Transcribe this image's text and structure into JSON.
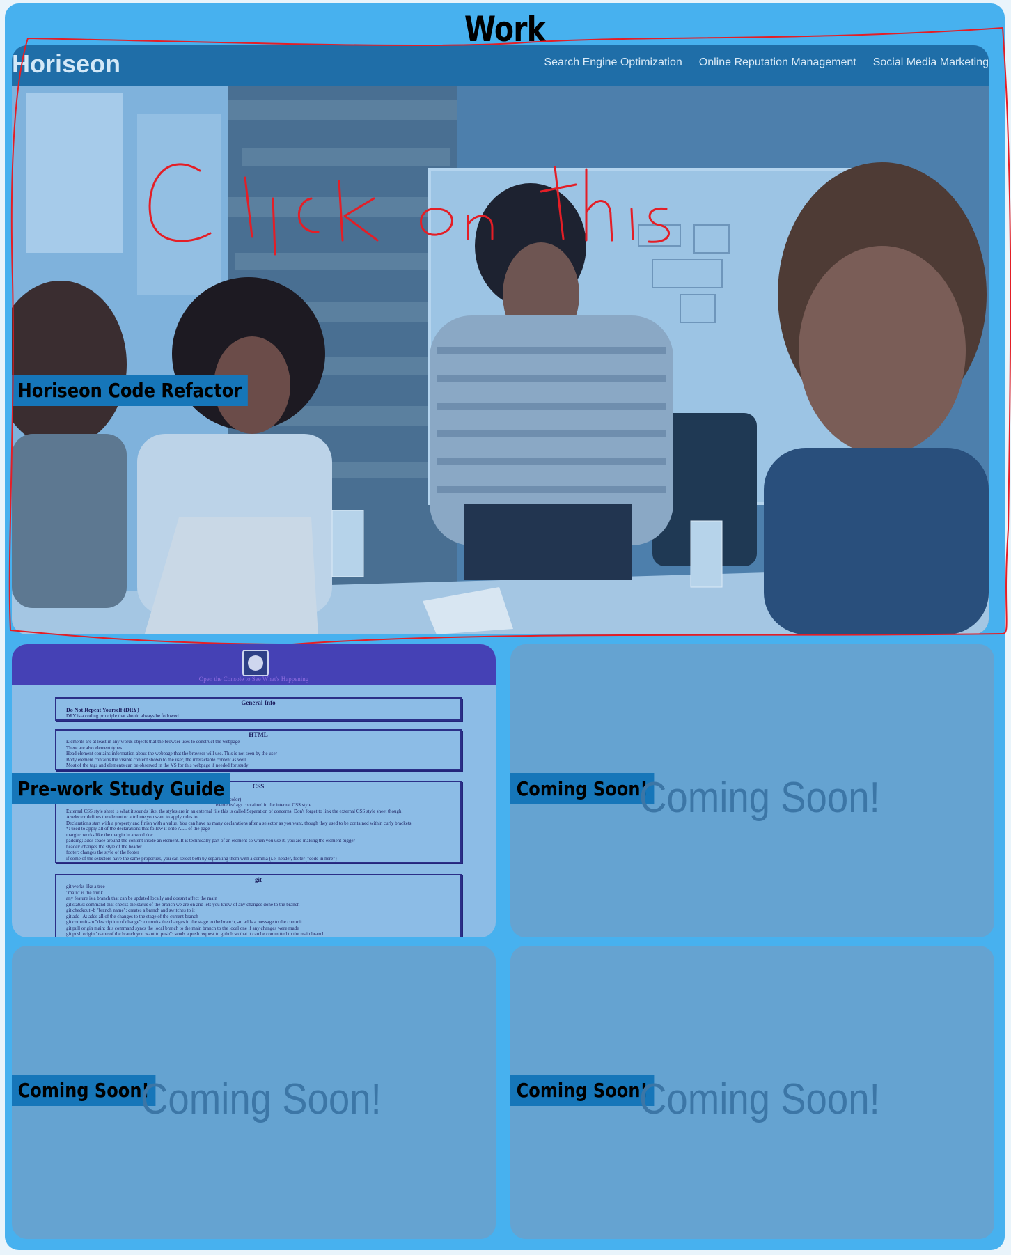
{
  "page": {
    "title": "Work"
  },
  "hero": {
    "brand": "Horiseon",
    "nav": [
      "Search Engine Optimization",
      "Online Reputation Management",
      "Social Media Marketing"
    ],
    "label": "Horiseon Code Refactor",
    "annotation": "Click on this"
  },
  "guide": {
    "label": "Pre-work Study Guide",
    "subtitle": "Open the Console to See What's Happening",
    "sections": [
      {
        "title": "General Info",
        "subtitle": "Do Not Repeat Yourself (DRY)",
        "items": [
          "DRY is a coding principle that should always be followed"
        ]
      },
      {
        "title": "HTML",
        "items": [
          "Elements are at least in any words objects that the browser uses to construct the webpage",
          "There are also element types",
          "Head element contains information about the webpage that the browser will use. This is not seen by the user",
          "Body element contains the visible content shown to the user, the interactable content as well",
          "Most of the tags and elements can be observed in the VS for this webpage if needed for study"
        ]
      },
      {
        "title": "CSS",
        "items": [
          "app",
          "give it color)",
          "elements/tags contained in the internal CSS style",
          "External CSS style sheet is what it sounds like, the styles are in an external file this is called Separation of concerns. Don't forget to link the external CSS style sheet though!",
          "A selector defines the elemnt or attribute you want to apply rules to",
          "Declarations start with a property and finish with a value. You can have as many declarations after a selector as you want, though they used to be contained within curly brackets",
          "*: used to apply all of the declarations that follow it onto ALL of the page",
          "margin: works like the margin in a word doc",
          "padding: adds space around the content inside an element. It is technically part of an element so when you use it, you are making the element bigger",
          "header: changes the style of the header",
          "footer: changes the style of the footer",
          "if some of the selectors have the same properties, you can select both by separating them with a comma (i.e. header, footer{\"code in here\"}"
        ]
      },
      {
        "title": "git",
        "items": [
          "git works like a tree",
          "\"main\" is the trunk",
          "any feature is a branch that can be updated locally and doesn't affect the main",
          "git status: command that checks the status of the branch we are on and lets you know of any changes done to the branch",
          "git checkout -b \"branch name\": creates a branch and switches to it",
          "git add -A: adds all of the changes to the stage of the current branch",
          "git commit -m \"description of change\": commits the changes in the stage to the branch, -m adds a message to the commit",
          "git pull origin main: this command syncs the local branch to the main branch to the local one if any changes were made",
          "git push origin \"name of the branch you want to push\": sends a push request to github so that it can be committed to the main branch"
        ]
      }
    ]
  },
  "cards": [
    {
      "label": "Coming Soon!",
      "text": "Coming Soon!"
    },
    {
      "label": "Coming Soon!",
      "text": "Coming Soon!"
    },
    {
      "label": "Coming Soon!",
      "text": "Coming Soon!"
    }
  ],
  "colors": {
    "background": "#47b1ef",
    "label_bg": "#1676b9",
    "card": "#65a3d1",
    "hero_nav": "#1f6ea8",
    "guide_header": "#4541b5",
    "annotation": "#e41e26"
  }
}
